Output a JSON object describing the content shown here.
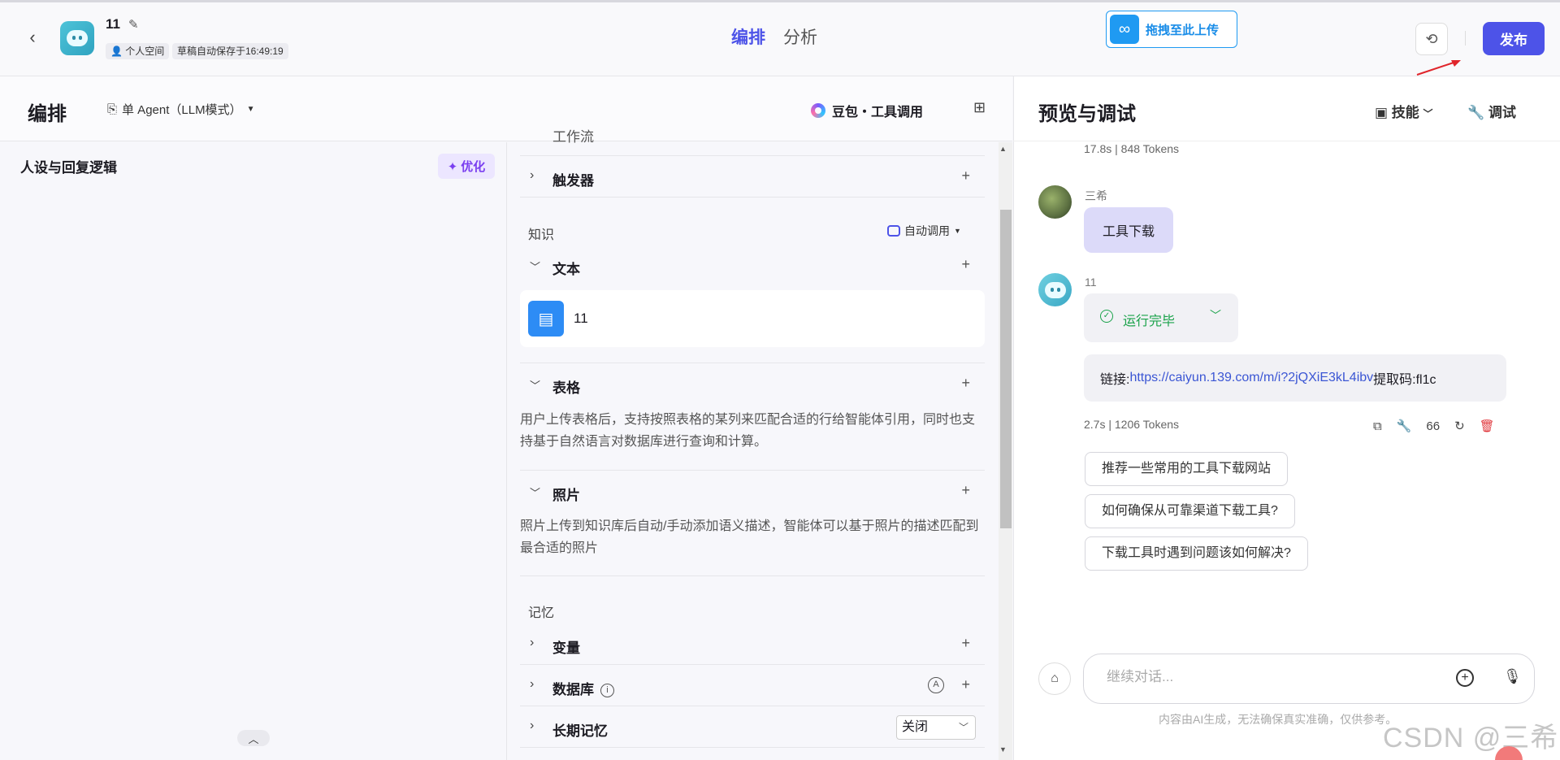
{
  "header": {
    "bot_name": "11",
    "space_label": "个人空间",
    "autosave_label": "草稿自动保存于16:49:19",
    "tabs": [
      "编排",
      "分析"
    ],
    "upload_label": "拖拽至此上传",
    "publish_label": "发布"
  },
  "editor": {
    "title": "编排",
    "mode_label": "单 Agent（LLM模式）",
    "model_label": "豆包・工具调用"
  },
  "persona": {
    "title": "人设与回复逻辑",
    "optimize_label": "优化"
  },
  "skills": {
    "partial_label": "工作流",
    "trigger_label": "触发器",
    "knowledge_group": "知识",
    "auto_call_label": "自动调用",
    "text_label": "文本",
    "text_item_name": "11",
    "table_label": "表格",
    "table_desc": "用户上传表格后，支持按照表格的某列来匹配合适的行给智能体引用，同时也支持基于自然语言对数据库进行查询和计算。",
    "photo_label": "照片",
    "photo_desc": "照片上传到知识库后自动/手动添加语义描述，智能体可以基于照片的描述匹配到最合适的照片",
    "memory_group": "记忆",
    "variable_label": "变量",
    "database_label": "数据库",
    "longterm_label": "长期记忆",
    "longterm_value": "关闭"
  },
  "preview": {
    "title": "预览与调试",
    "skills_label": "技能",
    "debug_label": "调试",
    "prev_meta": "17.8s  |  848 Tokens",
    "user_name": "三希",
    "user_message": "工具下载",
    "bot_name": "11",
    "run_status": "运行完毕",
    "link_prefix": "链接: ",
    "link_url": "https://caiyun.139.com/m/i?2jQXiE3kL4ibv",
    "link_suffix": " 提取码:fl1c",
    "reply_meta": "2.7s  |  1206 Tokens",
    "quote_count": "66",
    "suggestions": [
      "推荐一些常用的工具下载网站",
      "如何确保从可靠渠道下载工具?",
      "下载工具时遇到问题该如何解决?"
    ],
    "input_placeholder": "继续对话...",
    "disclaimer": "内容由AI生成，无法确保真实准确，仅供参考。"
  },
  "watermark": "CSDN @三希",
  "colors": {
    "accent": "#4d53e8",
    "success": "#1aa24a",
    "link": "#3b56d4",
    "danger": "#e0363b"
  }
}
